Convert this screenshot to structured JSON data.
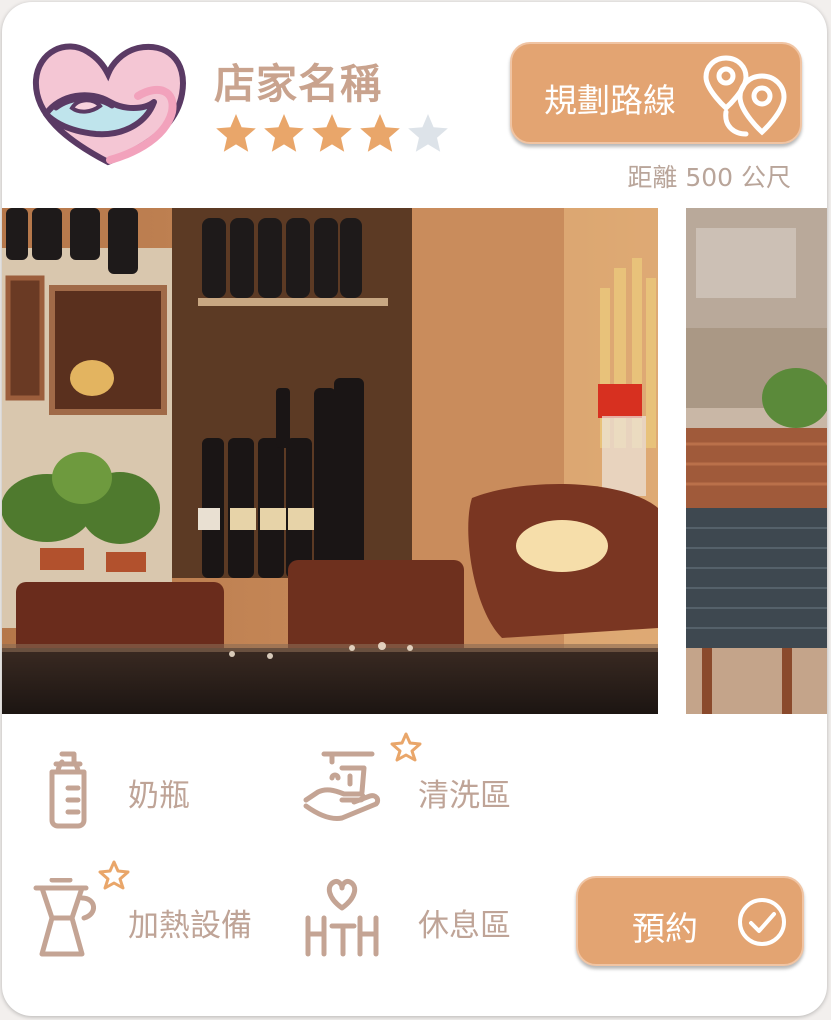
{
  "shop": {
    "name": "店家名稱",
    "rating": 4,
    "rating_max": 5,
    "logo_icon": "heart-hands-logo"
  },
  "route_button": {
    "label": "規劃路線",
    "icon": "map-pins-route-icon"
  },
  "distance": "距離 500 公尺",
  "carousel": {
    "current": 1,
    "total": 3
  },
  "amenities": [
    {
      "label": "奶瓶",
      "icon": "baby-bottle-icon",
      "featured": false
    },
    {
      "label": "清洗區",
      "icon": "hand-washing-icon",
      "featured": true
    },
    {
      "label": "加熱設備",
      "icon": "kettle-heater-icon",
      "featured": true
    },
    {
      "label": "休息區",
      "icon": "rest-area-heart-icon",
      "featured": false
    }
  ],
  "book_button": {
    "label": "預約",
    "icon": "check-circle-icon"
  },
  "colors": {
    "accent": "#e3a472",
    "star_filled": "#e9a66a",
    "star_empty": "#dde3e9",
    "text_muted": "#bfa497",
    "title": "#c9a38e"
  }
}
